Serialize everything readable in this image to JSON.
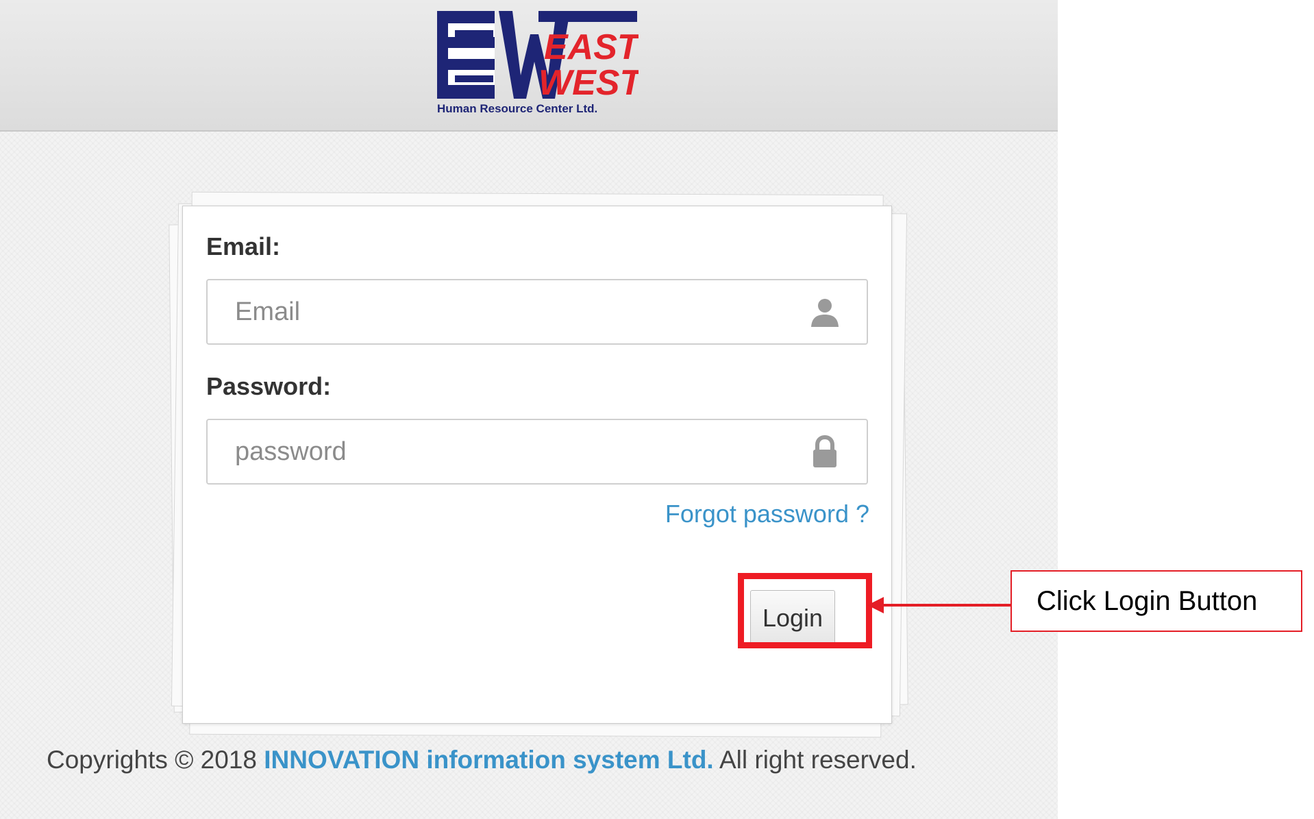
{
  "header": {
    "logo": {
      "mark": "EW",
      "line1": "EAST",
      "line2": "WEST",
      "tagline": "Human Resource Center Ltd."
    }
  },
  "login_form": {
    "email_label": "Email:",
    "email_placeholder": "Email",
    "email_value": "",
    "password_label": "Password:",
    "password_placeholder": "password",
    "password_value": "",
    "forgot_password": "Forgot password ?",
    "login_button": "Login"
  },
  "footer": {
    "copyright_prefix": "Copyrights © 2018",
    "company": "INNOVATION information system Ltd.",
    "copyright_suffix": "All right reserved."
  },
  "annotation": {
    "callout_text": "Click Login Button",
    "highlight_color": "#ee1c24"
  },
  "colors": {
    "link": "#3a93c9",
    "logo_navy": "#1e2576",
    "logo_red": "#e3242b"
  },
  "icons": {
    "email_field": "user-icon",
    "password_field": "lock-icon"
  }
}
